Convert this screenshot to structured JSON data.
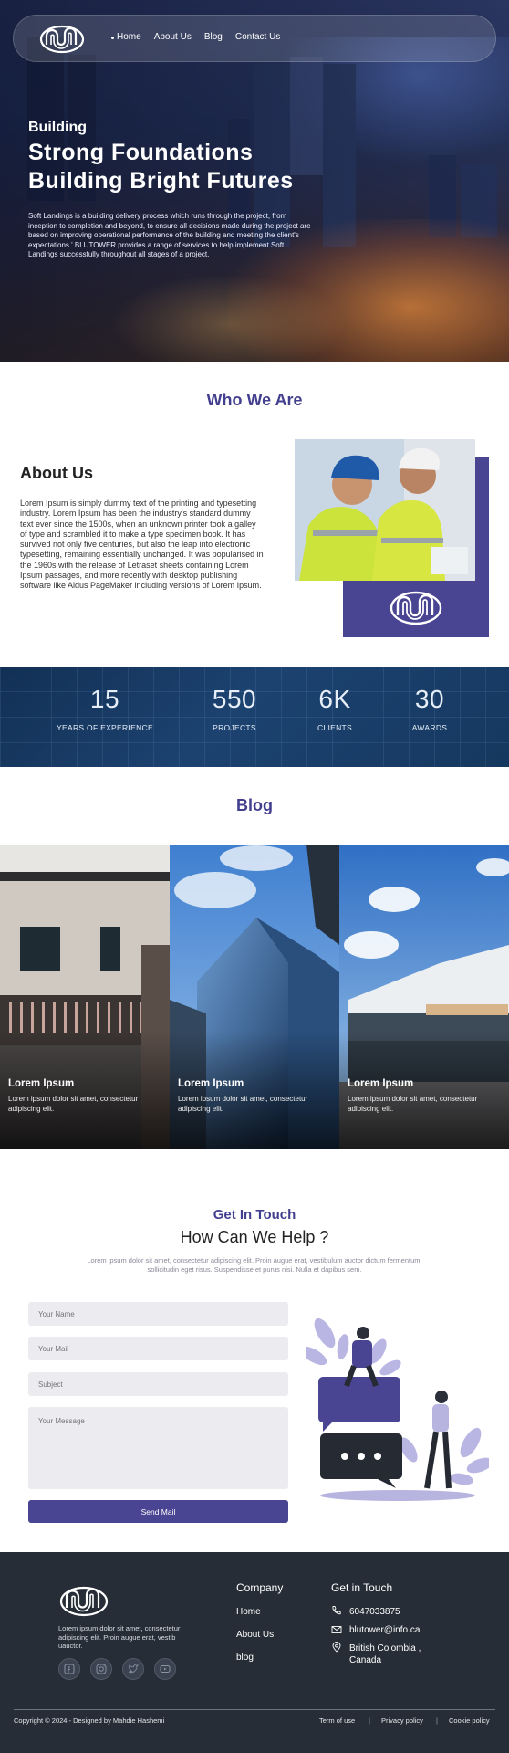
{
  "nav": {
    "items": [
      "Home",
      "About Us",
      "Blog",
      "Contact Us"
    ]
  },
  "hero": {
    "kicker": "Building",
    "title_line1": "Strong Foundations",
    "title_line2": "Building Bright Futures",
    "description": "Soft Landings is a building delivery process which runs through the project, from inception to completion and beyond, to ensure all decisions made during the project are based on improving operational performance of the building and meeting the client's expectations.' BLUTOWER provides a range of services to help implement Soft Landings successfully throughout all stages of a project."
  },
  "who": {
    "title": "Who We Are",
    "about_heading": "About Us",
    "about_text": "Lorem Ipsum is simply dummy text of the printing and typesetting industry. Lorem Ipsum has been the industry's standard dummy text ever since the 1500s, when an unknown printer took a galley of type and scrambled it to make a type specimen book. It has survived not only five centuries, but also the leap into electronic typesetting, remaining essentially unchanged. It was popularised in the 1960s with the release of Letraset sheets containing Lorem Ipsum passages, and more recently with desktop publishing software like Aldus PageMaker including versions of Lorem Ipsum."
  },
  "stats": [
    {
      "value": "15",
      "label": "YEARS OF EXPERIENCE"
    },
    {
      "value": "550",
      "label": "PROJECTS"
    },
    {
      "value": "6K",
      "label": "CLIENTS"
    },
    {
      "value": "30",
      "label": "AWARDS"
    }
  ],
  "blog": {
    "title": "Blog",
    "cards": [
      {
        "title": "Lorem Ipsum",
        "text": "Lorem ipsum dolor sit amet, consectetur adipiscing elit."
      },
      {
        "title": "Lorem Ipsum",
        "text": "Lorem ipsum dolor sit amet, consectetur adipiscing elit."
      },
      {
        "title": "Lorem Ipsum",
        "text": "Lorem ipsum dolor sit amet, consectetur adipiscing elit."
      }
    ]
  },
  "contact": {
    "kicker": "Get In Touch",
    "heading": "How Can We Help ?",
    "text": "Lorem ipsum dolor sit amet, consectetur adipiscing elit. Proin augue erat, vestibulum auctor dictum fermentum, sollicitudin eget risus. Suspendisse et purus nisi. Nulla et dapibus sem.",
    "name_placeholder": "Your Name",
    "mail_placeholder": "Your Mail",
    "subject_placeholder": "Subject",
    "message_placeholder": "Your Message",
    "send_label": "Send Mail"
  },
  "footer": {
    "description": "Lorem ipsum dolor sit amet, consectetur adipiscing elit. Proin augue erat, vestib uauctor.",
    "company_heading": "Company",
    "company_links": [
      "Home",
      "About Us",
      "blog"
    ],
    "touch_heading": "Get in Touch",
    "phone": "6047033875",
    "email": "blutower@info.ca",
    "address_line1": "British Colombia ,",
    "address_line2": "Canada",
    "socials": [
      "facebook-icon",
      "instagram-icon",
      "twitter-icon",
      "youtube-icon"
    ],
    "copyright": "Copyright © 2024 - Designed by Mahdie Hashemi",
    "legal": [
      "Term of use",
      "Privacy policy",
      "Cookie policy"
    ],
    "legal_separator": "|"
  },
  "colors": {
    "brand": "#4a4592",
    "title": "#433f8f",
    "footer_bg": "#262d36",
    "stats_bg": "#1c4270"
  }
}
